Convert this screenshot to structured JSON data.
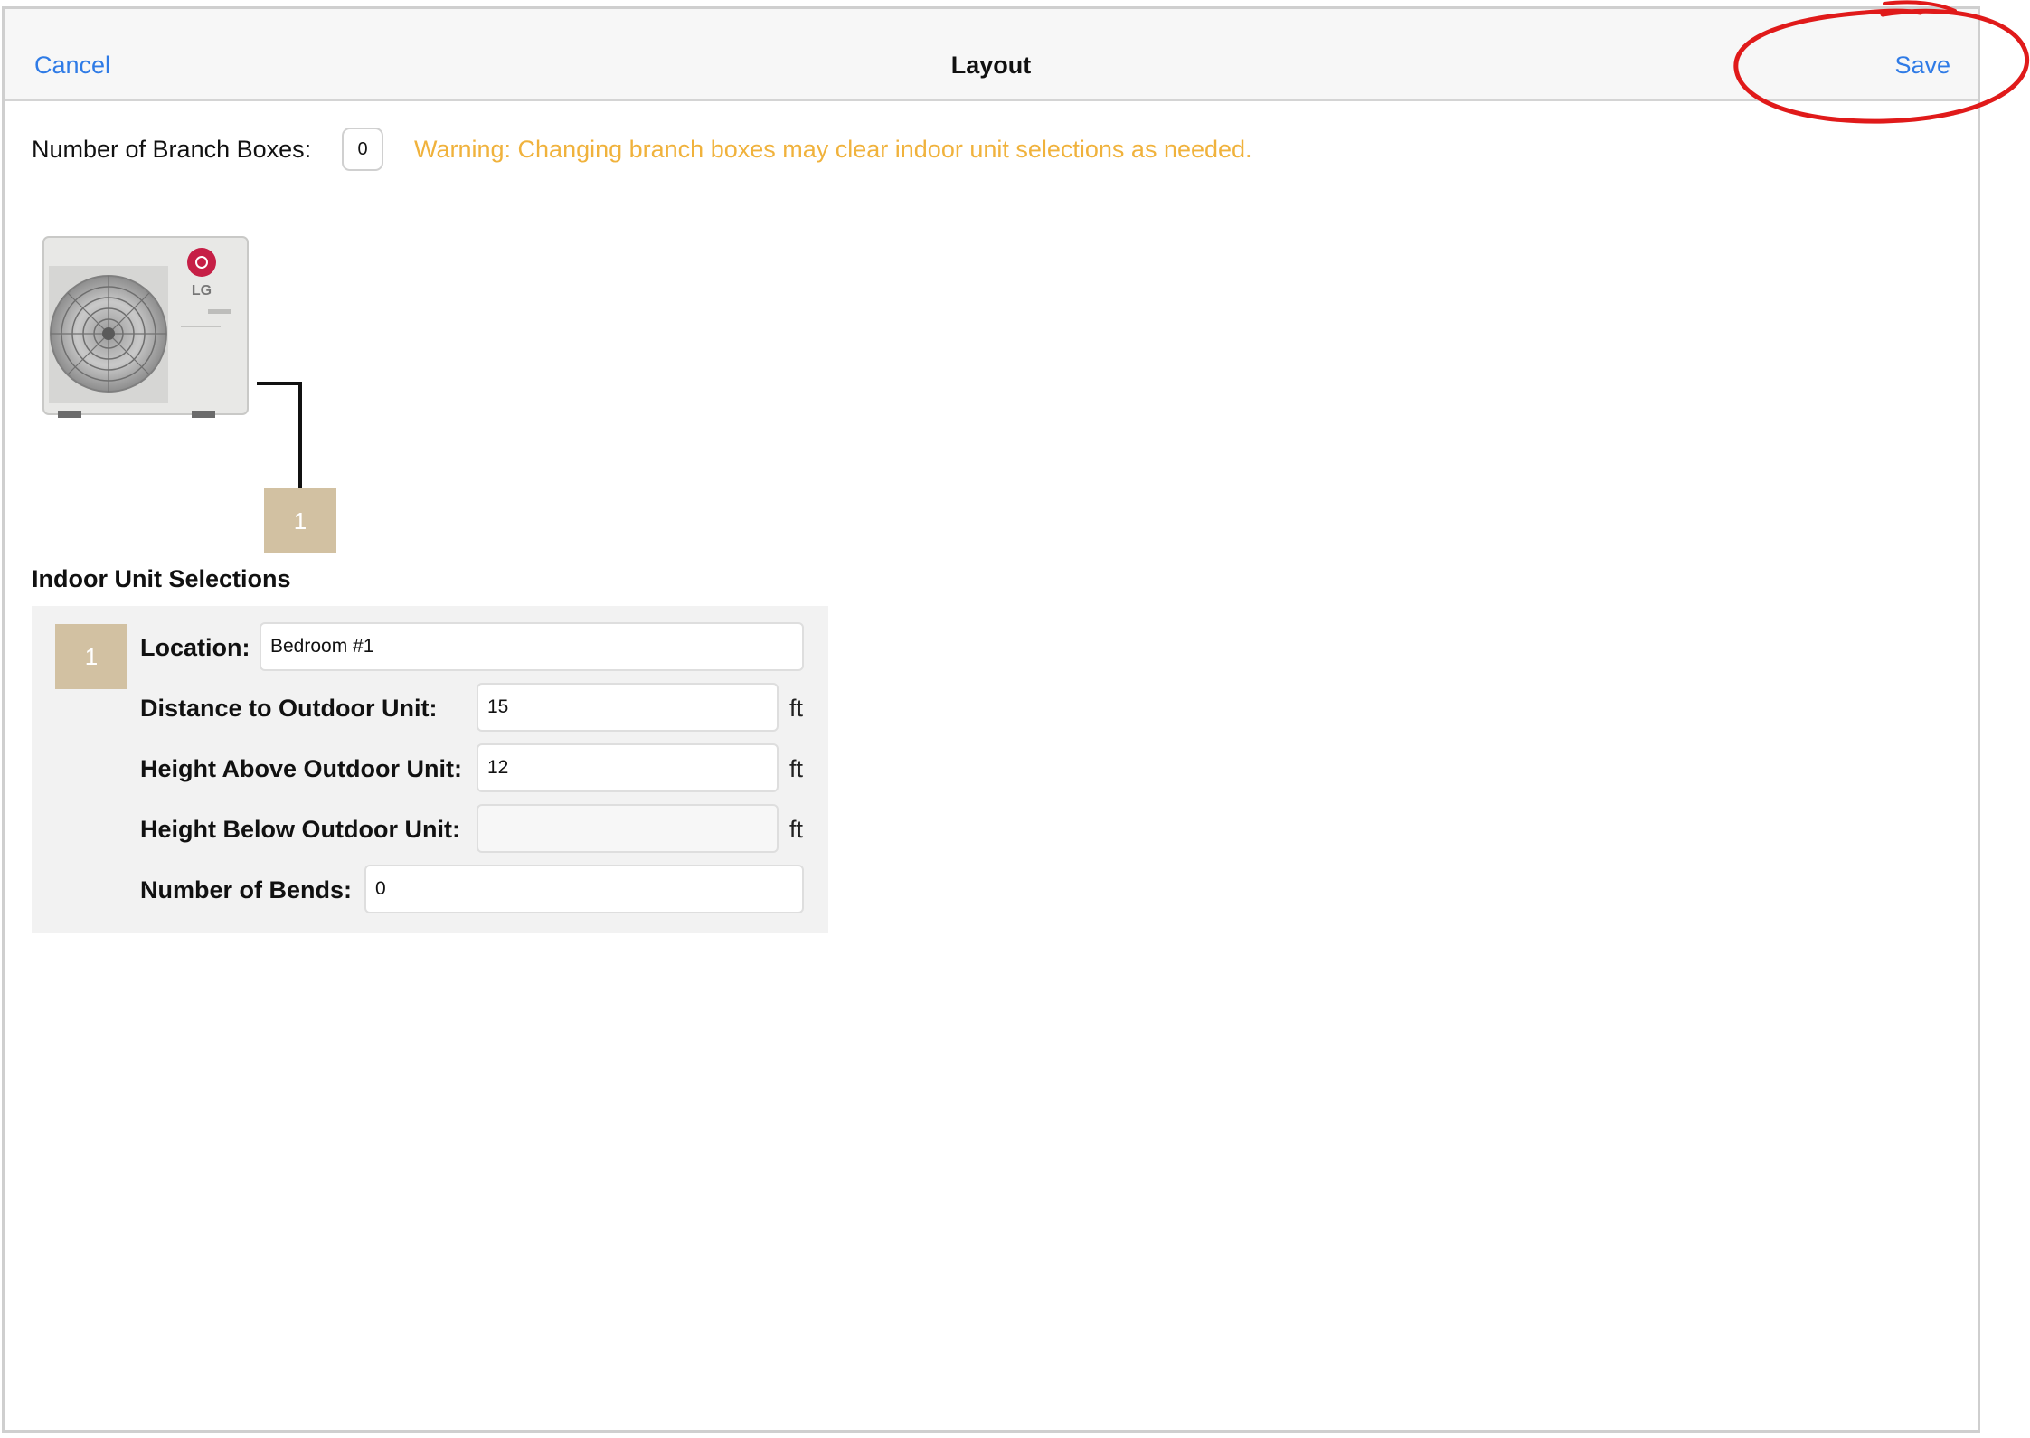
{
  "navbar": {
    "cancel_label": "Cancel",
    "title": "Layout",
    "save_label": "Save"
  },
  "branch_boxes": {
    "label": "Number of Branch Boxes:",
    "value": "0",
    "warning": "Warning: Changing branch boxes may clear indoor unit selections as needed."
  },
  "diagram": {
    "outdoor_unit_brand": "LG",
    "unit_number": "1"
  },
  "indoor_units": {
    "section_title": "Indoor Unit Selections",
    "items": [
      {
        "number": "1",
        "location_label": "Location:",
        "location_value": "Bedroom #1",
        "distance_label": "Distance to Outdoor Unit:",
        "distance_value": "15",
        "height_above_label": "Height Above Outdoor Unit:",
        "height_above_value": "12",
        "height_below_label": "Height Below Outdoor Unit:",
        "height_below_value": "",
        "bends_label": "Number of Bends:",
        "bends_value": "0",
        "unit": "ft"
      }
    ]
  },
  "colors": {
    "accent": "#2f7be6",
    "warning": "#f0b23c",
    "unit_box": "#d2c1a2",
    "annotation": "#e01a1a"
  }
}
